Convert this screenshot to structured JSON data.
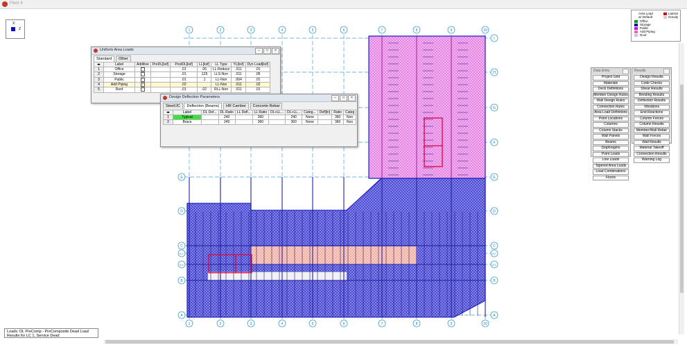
{
  "window": {
    "title": "Floor 4"
  },
  "axis": {
    "x_label": "X",
    "z_label": "Z"
  },
  "grid": {
    "columns": [
      "1",
      "2",
      "3",
      "4",
      "5",
      "6",
      "7",
      "8",
      "9",
      "10"
    ],
    "rows_left": [
      "A",
      "B",
      "B.4",
      "B.7",
      "C",
      "D",
      "E"
    ],
    "rows_right": [
      "A",
      "B",
      "B.4",
      "B.7",
      "C",
      "D",
      "E",
      "F",
      "G",
      "H",
      "I"
    ]
  },
  "uniform_loads": {
    "title": "Uniform Area Loads",
    "tabs": [
      "Standard",
      "Other"
    ],
    "headers": [
      "",
      "Label",
      "Additive",
      "PreDL[ksf]",
      "PostDL[ksf]",
      "LL[ksf]",
      "LL Type",
      "YL[ksf]",
      "Dyn Load[ksf]"
    ],
    "rows": [
      {
        "n": "1",
        "label": "Office",
        "additive": false,
        "pre": "",
        "post": ".01",
        "ll": ".05",
        "lltype": "LL-Reduce",
        "yl": ".011",
        "dyn": ".01"
      },
      {
        "n": "2",
        "label": "Storage",
        "additive": false,
        "pre": "",
        "post": ".01",
        "ll": ".125",
        "lltype": "LLS-Non",
        "yl": ".011",
        "dyn": ".05"
      },
      {
        "n": "3",
        "label": "Public",
        "additive": false,
        "pre": "",
        "post": ".01",
        "ll": ".1",
        "lltype": "LL-Non",
        "yl": ".004",
        "dyn": ".01"
      },
      {
        "n": "4",
        "label": "Add Piping",
        "additive": true,
        "pre": "",
        "post": ".02",
        "ll": "",
        "lltype": "LL-Non",
        "yl": ".011",
        "dyn": ".02"
      },
      {
        "n": "5",
        "label": "Roof",
        "additive": false,
        "pre": "",
        "post": ".01",
        "ll": ".02",
        "lltype": "RLL-Non",
        "yl": ".011",
        "dyn": ".01"
      }
    ]
  },
  "deflection": {
    "title": "Design Deflection Parameters",
    "tabs": [
      "Steel/JC",
      "Deflection (Beams)",
      "HR Camber",
      "Concrete Rebar"
    ],
    "headers": [
      "",
      "Label",
      "DL Def...",
      "DL Ratio",
      "LL Defl...",
      "LL Ratio",
      "DL+LL...",
      "DL+LL...",
      "Categ...",
      "Defl[in]",
      "Ratio",
      "Categ"
    ],
    "rows": [
      {
        "n": "1",
        "label": "Typical",
        "c1": "",
        "c2": "240",
        "c3": "",
        "c4": "360",
        "c5": "",
        "c6": "240",
        "c7": "None",
        "c8": "",
        "c9": "360",
        "c10": "Non"
      },
      {
        "n": "2",
        "label": "Brace",
        "c1": "",
        "c2": "240",
        "c3": "",
        "c4": "360",
        "c5": "",
        "c6": "360",
        "c7": "None",
        "c8": "",
        "c9": "360",
        "c10": "Non"
      }
    ]
  },
  "legend": {
    "left": [
      "Area Load",
      "w/ Default",
      "Office",
      "Storage",
      "Public",
      "Add Piping",
      "Roof"
    ],
    "right": [
      "Lateral",
      "Gravity"
    ],
    "colors": {
      "office": "#00a000",
      "storage": "#0000c0",
      "public": "#e000e0",
      "piping": "#ff60a0",
      "roof": "#c0c0ff",
      "lateral": "#e00000",
      "gravity": "#f0c0c0"
    }
  },
  "data_entry": {
    "title": "Data Entry",
    "items": [
      "Project Grid",
      "Materials",
      "Deck Definitions",
      "Member Design Rules",
      "Wall Design Rules",
      "Connection Rules",
      "Area Load Definitions",
      "Point Locations",
      "Columns",
      "Column Stacks",
      "Wall Panels",
      "Beams",
      "Diaphragms",
      "Point Loads",
      "Line Loads",
      "Tapered Area Loads",
      "Load Combinations",
      "Floors"
    ]
  },
  "results": {
    "title": "Results",
    "items": [
      "Design Results",
      "Code Checks",
      "Shear Results",
      "Bending Results",
      "Deflection Results",
      "Vibrations",
      "End Reactions",
      "Column Forces",
      "Column Results",
      "Member/Wall Rebar",
      "Wall Forces",
      "Wall Results",
      "Material Takeoff",
      "Connection Results",
      "Warning Log"
    ]
  },
  "status": {
    "line1": "Loads: DL PreComp - PreComposite Dead Load",
    "line2": "Results for LC 1, Service Dead"
  },
  "colors": {
    "storage_fill": "#5050d8",
    "roof_fill": "#f0a0f0",
    "pink_band": "#ffc8c8",
    "beam_red": "#e00040",
    "grid_blue": "#40a0d0"
  }
}
